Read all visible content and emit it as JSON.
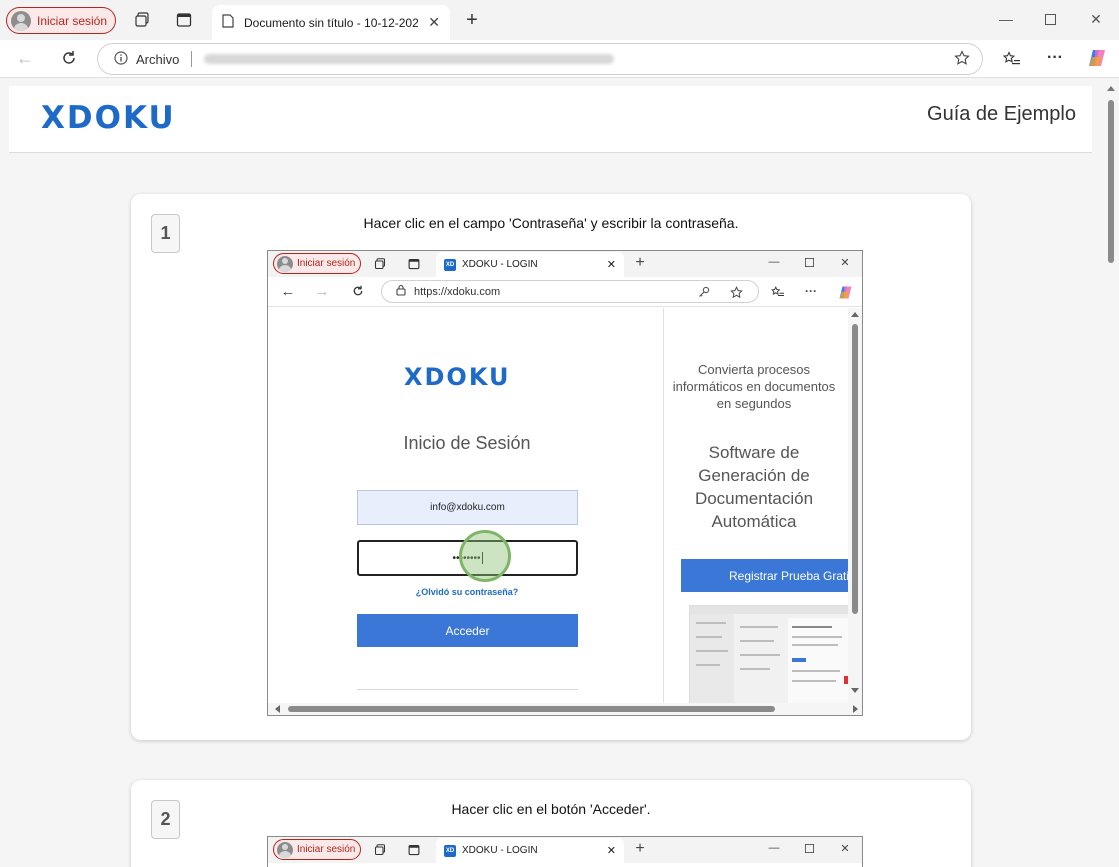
{
  "browser": {
    "profile_label": "Iniciar sesión",
    "tab_title": "Documento sin título - 10-12-202",
    "address_prefix": "Archivo",
    "icons": [
      "profile-icon",
      "workspaces-icon",
      "vertical-tabs-icon",
      "document-icon",
      "close-icon",
      "new-tab-icon",
      "minimize-icon",
      "maximize-icon",
      "window-close-icon",
      "back-icon",
      "refresh-icon",
      "info-icon",
      "favorite-icon",
      "favorites-list-icon",
      "more-icon",
      "copilot-icon"
    ]
  },
  "document": {
    "logo_text": "XDOKU",
    "title": "Guía de Ejemplo",
    "brand_color": "#1e6ac8"
  },
  "steps": [
    {
      "number": "1",
      "instruction": "Hacer clic en el campo 'Contraseña' y escribir la contraseña."
    },
    {
      "number": "2",
      "instruction": "Hacer clic en el botón 'Acceder'."
    }
  ],
  "screenshot": {
    "profile_label": "Iniciar sesión",
    "favicon_text": "XD",
    "tab_title": "XDOKU - LOGIN",
    "url": "https://xdoku.com",
    "logo_text": "XDOKU",
    "login_title": "Inicio de Sesión",
    "email_value": "info@xdoku.com",
    "password_value": "••••••••",
    "forgot_link": "¿Olvidó su contraseña?",
    "submit_label": "Acceder",
    "promo_line_1": "Convierta procesos informáticos en documentos en segundos",
    "promo_line_2": "Software de Generación de Documentación Automática",
    "register_label": "Registrar Prueba Gratis",
    "accent_color": "#3a77d6",
    "click_marker_color": "#7fb567"
  }
}
